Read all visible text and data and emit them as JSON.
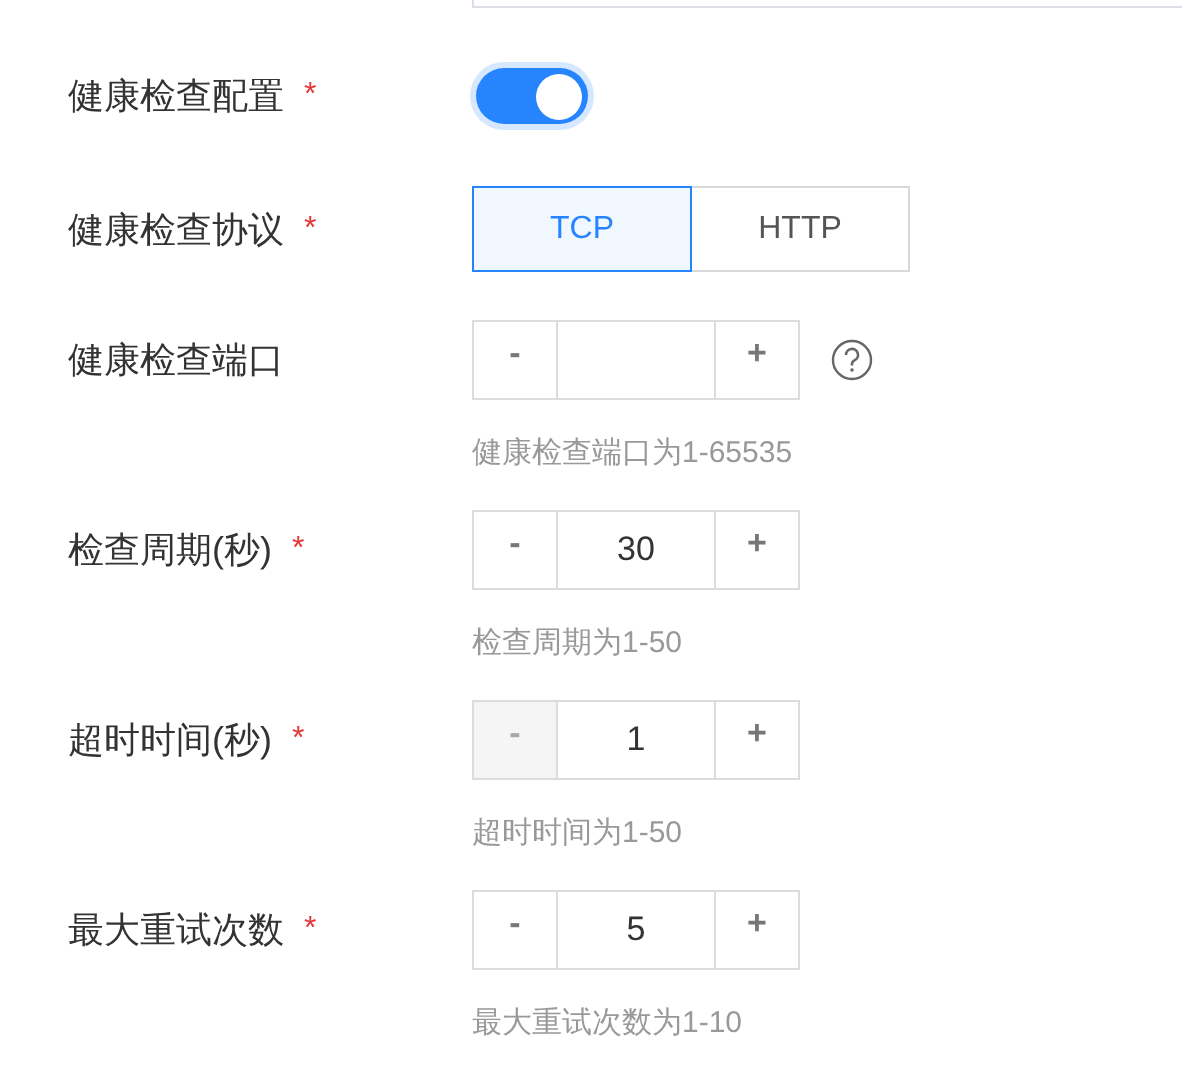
{
  "fields": [
    {
      "kind": "toggle",
      "label": "健康检查配置",
      "mark": "*",
      "on": true
    },
    {
      "kind": "segmented",
      "label": "健康检查协议",
      "mark": "*",
      "options": [
        {
          "label": "TCP",
          "selected": true
        },
        {
          "label": "HTTP",
          "selected": false
        }
      ]
    },
    {
      "kind": "stepper",
      "label": "健康检查端口",
      "minus": "-",
      "plus": "+",
      "minus_disabled": false,
      "help": true,
      "hint": "健康检查端口为1-65535"
    },
    {
      "kind": "stepper",
      "label": "检查周期(秒)",
      "mark": "*",
      "minus": "-",
      "plus": "+",
      "value": "30",
      "minus_disabled": false,
      "help": false,
      "hint": "检查周期为1-50"
    },
    {
      "kind": "stepper",
      "label": "超时时间(秒)",
      "mark": "*",
      "minus": "-",
      "plus": "+",
      "value": "1",
      "minus_disabled": true,
      "help": false,
      "hint": "超时时间为1-50"
    },
    {
      "kind": "stepper",
      "label": "最大重试次数",
      "mark": "*",
      "minus": "-",
      "plus": "+",
      "value": "5",
      "minus_disabled": false,
      "help": false,
      "hint": "最大重试次数为1-10"
    }
  ]
}
